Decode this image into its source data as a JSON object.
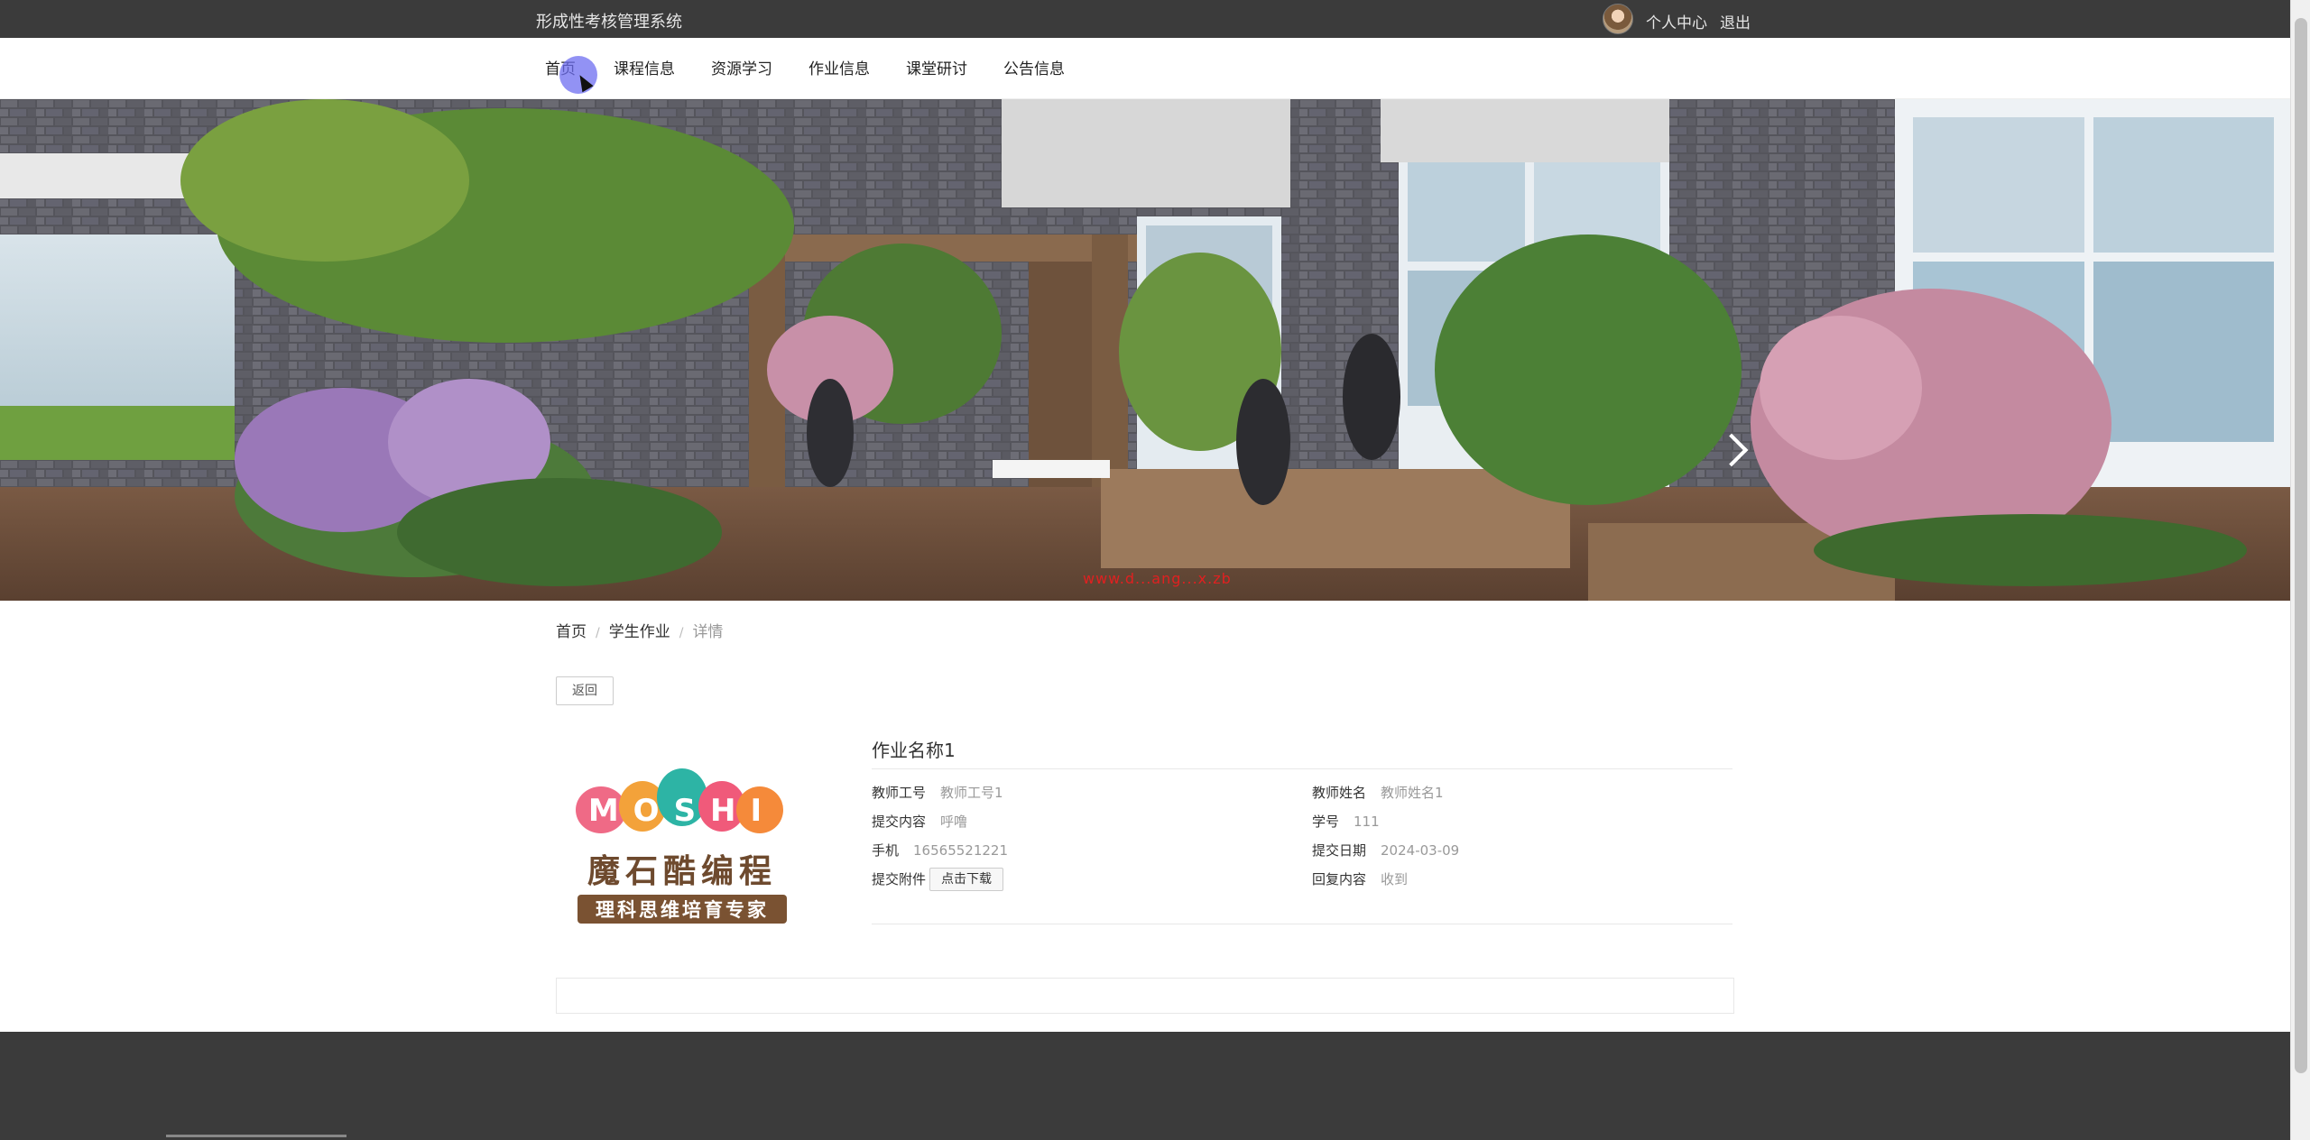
{
  "header": {
    "site_title": "形成性考核管理系统",
    "user_center": "个人中心",
    "logout": "退出"
  },
  "nav": {
    "items": [
      "首页",
      "课程信息",
      "资源学习",
      "作业信息",
      "课堂研讨",
      "公告信息"
    ]
  },
  "banner": {
    "watermark": "www.d...ang...x.zb"
  },
  "breadcrumb": {
    "home": "首页",
    "section": "学生作业",
    "current": "详情",
    "separator": "/"
  },
  "actions": {
    "back": "返回"
  },
  "detail": {
    "title": "作业名称1",
    "left_fields": [
      {
        "label": "教师工号",
        "value": "教师工号1"
      },
      {
        "label": "提交内容",
        "value": "呼噜"
      },
      {
        "label": "手机",
        "value": "16565521221"
      },
      {
        "label": "提交附件",
        "value": "点击下载"
      }
    ],
    "right_fields": [
      {
        "label": "教师姓名",
        "value": "教师姓名1"
      },
      {
        "label": "学号",
        "value": "111"
      },
      {
        "label": "提交日期",
        "value": "2024-03-09"
      },
      {
        "label": "回复内容",
        "value": "收到"
      }
    ]
  },
  "image": {
    "logo_text_top": "MOSHI",
    "logo_text_main": "魔石酷编程",
    "logo_text_sub": "理科思维培育专家"
  },
  "colors": {
    "topbar_bg": "#3b3b3b",
    "footer_bg": "#3b3b3b",
    "cursor_highlight": "#6e6ef0"
  }
}
